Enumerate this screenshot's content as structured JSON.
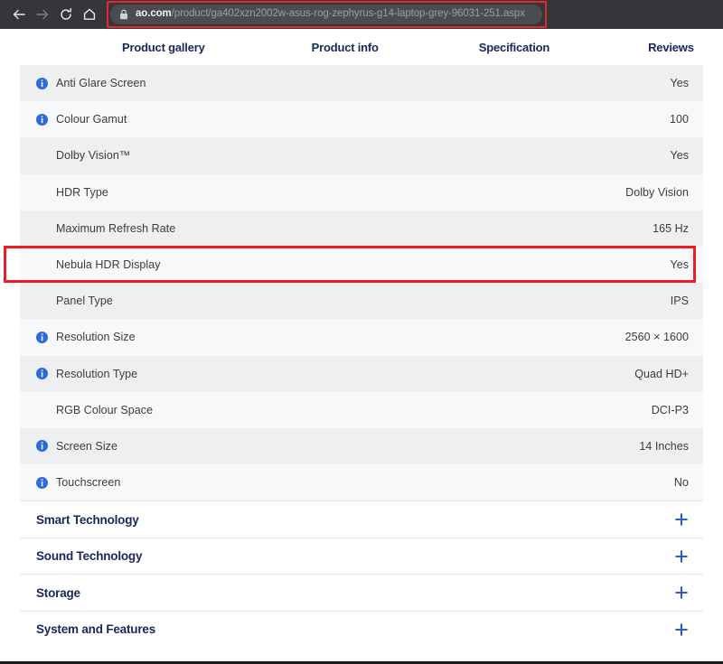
{
  "browser": {
    "back_icon": "back-arrow-icon",
    "forward_icon": "forward-arrow-icon",
    "reload_icon": "reload-icon",
    "home_icon": "home-icon",
    "lock_icon": "lock-icon",
    "url_host": "ao.com",
    "url_path": "/product/ga402xzn2002w-asus-rog-zephyrus-g14-laptop-grey-96031-251.aspx",
    "annotation_color": "#e8262b"
  },
  "tabs": [
    {
      "label": "Product gallery"
    },
    {
      "label": "Product info"
    },
    {
      "label": "Specification"
    },
    {
      "label": "Reviews"
    }
  ],
  "spec_rows": [
    {
      "label": "Anti Glare Screen",
      "value": "Yes",
      "info": true
    },
    {
      "label": "Colour Gamut",
      "value": "100",
      "info": true
    },
    {
      "label": "Dolby Vision™",
      "value": "Yes",
      "info": false
    },
    {
      "label": "HDR Type",
      "value": "Dolby Vision",
      "info": false
    },
    {
      "label": "Maximum Refresh Rate",
      "value": "165 Hz",
      "info": false
    },
    {
      "label": "Nebula HDR Display",
      "value": "Yes",
      "info": false,
      "highlighted": true
    },
    {
      "label": "Panel Type",
      "value": "IPS",
      "info": false
    },
    {
      "label": "Resolution Size",
      "value": "2560 × 1600",
      "info": true
    },
    {
      "label": "Resolution Type",
      "value": "Quad HD+",
      "info": true
    },
    {
      "label": "RGB Colour Space",
      "value": "DCI-P3",
      "info": false
    },
    {
      "label": "Screen Size",
      "value": "14 Inches",
      "info": true
    },
    {
      "label": "Touchscreen",
      "value": "No",
      "info": true
    }
  ],
  "sections": [
    {
      "title": "Smart Technology",
      "expand_icon": "plus-icon"
    },
    {
      "title": "Sound Technology",
      "expand_icon": "plus-icon"
    },
    {
      "title": "Storage",
      "expand_icon": "plus-icon"
    },
    {
      "title": "System and Features",
      "expand_icon": "plus-icon"
    }
  ],
  "colors": {
    "accent_blue": "#2e5bd8",
    "heading_navy": "#17295a",
    "info_icon_blue": "#2e6bd8",
    "annotation_red": "#ee1c25",
    "row_even": "#eeeff0",
    "row_odd": "#f7f8fa"
  }
}
